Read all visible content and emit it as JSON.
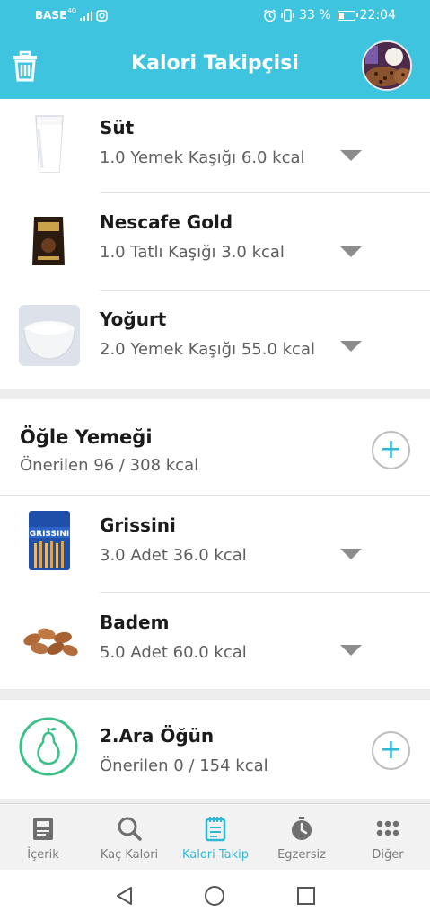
{
  "status_bar": {
    "carrier": "BASE",
    "network": "4G",
    "battery": "33 %",
    "battery_level": 0.33,
    "time": "22:04"
  },
  "app_bar": {
    "title": "Kalori Takipçisi",
    "left_icon": "trash-icon",
    "right_icon": "avatar"
  },
  "meals": [
    {
      "items": [
        {
          "name": "Süt",
          "detail": "1.0 Yemek Kaşığı 6.0 kcal",
          "icon": "milk-glass"
        },
        {
          "name": "Nescafe Gold",
          "detail": "1.0 Tatlı Kaşığı 3.0 kcal",
          "icon": "nescafe-pack"
        },
        {
          "name": "Yoğurt",
          "detail": "2.0 Yemek Kaşığı 55.0 kcal",
          "icon": "yogurt-bowl"
        }
      ]
    },
    {
      "title": "Öğle Yemeği",
      "subtitle": "Önerilen 96 / 308 kcal",
      "items": [
        {
          "name": "Grissini",
          "detail": "3.0 Adet 36.0 kcal",
          "icon": "grissini-pack"
        },
        {
          "name": "Badem",
          "detail": "5.0 Adet 60.0 kcal",
          "icon": "almonds"
        }
      ]
    },
    {
      "title": "2.Ara Öğün",
      "subtitle": "Önerilen 0 / 154 kcal",
      "icon": "pear-icon",
      "items": []
    }
  ],
  "bottom_nav": [
    {
      "label": "İçerik",
      "icon": "book-icon",
      "active": false
    },
    {
      "label": "Kaç Kalori",
      "icon": "search-icon",
      "active": false
    },
    {
      "label": "Kalori Takip",
      "icon": "tracker-icon",
      "active": true
    },
    {
      "label": "Egzersiz",
      "icon": "stopwatch-icon",
      "active": false
    },
    {
      "label": "Diğer",
      "icon": "more-icon",
      "active": false
    }
  ],
  "system_nav": [
    "back-icon",
    "home-icon",
    "recents-icon"
  ],
  "colors": {
    "primary": "#3fc4e0",
    "accent": "#2fb8d6",
    "pear_green": "#3cc08a"
  }
}
